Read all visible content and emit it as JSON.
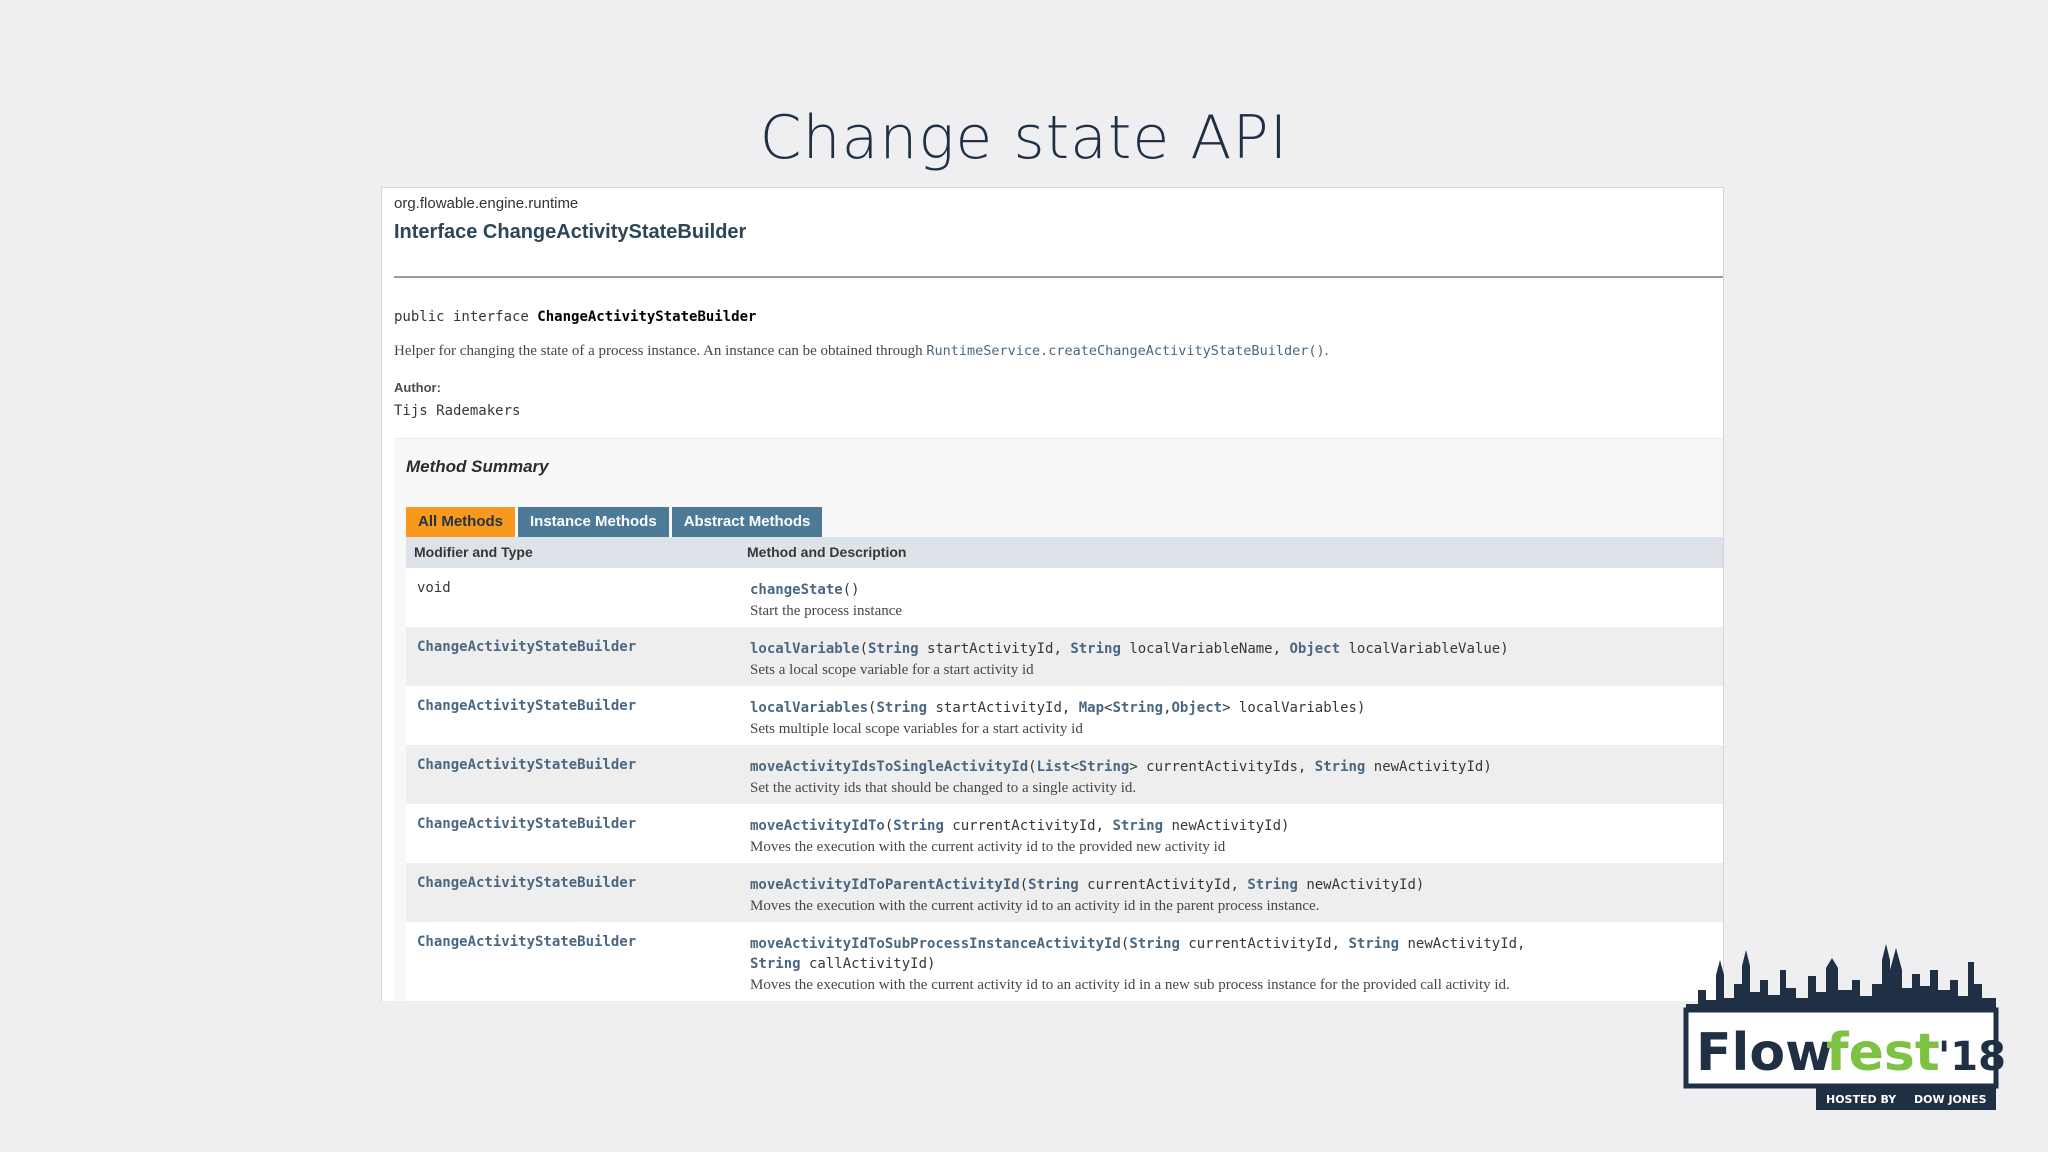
{
  "slide": {
    "title": "Change state API"
  },
  "doc": {
    "package": "org.flowable.engine.runtime",
    "interface_title": "Interface ChangeActivityStateBuilder",
    "declaration_prefix": "public interface ",
    "declaration_name": "ChangeActivityStateBuilder",
    "description_text": "Helper for changing the state of a process instance. An instance can be obtained through ",
    "description_link": "RuntimeService.createChangeActivityStateBuilder()",
    "description_end": ".",
    "author_label": "Author:",
    "author": "Tijs Rademakers"
  },
  "summary": {
    "title": "Method Summary",
    "tabs": [
      {
        "label": "All Methods",
        "active": true
      },
      {
        "label": "Instance Methods",
        "active": false
      },
      {
        "label": "Abstract Methods",
        "active": false
      }
    ],
    "headers": {
      "col1": "Modifier and Type",
      "col2": "Method and Description"
    },
    "rows": [
      {
        "type": "void",
        "link": false,
        "sig": [
          [
            "m",
            "changeState"
          ],
          [
            "p",
            "()"
          ]
        ],
        "desc": "Start the process instance"
      },
      {
        "type": "ChangeActivityStateBuilder",
        "link": true,
        "sig": [
          [
            "m",
            "localVariable"
          ],
          [
            "p",
            "("
          ],
          [
            "t",
            "String"
          ],
          [
            "p",
            " startActivityId, "
          ],
          [
            "t",
            "String"
          ],
          [
            "p",
            " localVariableName, "
          ],
          [
            "t",
            "Object"
          ],
          [
            "p",
            " localVariableValue)"
          ]
        ],
        "desc": "Sets a local scope variable for a start activity id"
      },
      {
        "type": "ChangeActivityStateBuilder",
        "link": true,
        "sig": [
          [
            "m",
            "localVariables"
          ],
          [
            "p",
            "("
          ],
          [
            "t",
            "String"
          ],
          [
            "p",
            " startActivityId, "
          ],
          [
            "t",
            "Map"
          ],
          [
            "p",
            "<"
          ],
          [
            "t",
            "String"
          ],
          [
            "p",
            ","
          ],
          [
            "t",
            "Object"
          ],
          [
            "p",
            "> localVariables)"
          ]
        ],
        "desc": "Sets multiple local scope variables for a start activity id"
      },
      {
        "type": "ChangeActivityStateBuilder",
        "link": true,
        "sig": [
          [
            "m",
            "moveActivityIdsToSingleActivityId"
          ],
          [
            "p",
            "("
          ],
          [
            "t",
            "List"
          ],
          [
            "p",
            "<"
          ],
          [
            "t",
            "String"
          ],
          [
            "p",
            "> currentActivityIds, "
          ],
          [
            "t",
            "String"
          ],
          [
            "p",
            " newActivityId)"
          ]
        ],
        "desc": "Set the activity ids that should be changed to a single activity id."
      },
      {
        "type": "ChangeActivityStateBuilder",
        "link": true,
        "sig": [
          [
            "m",
            "moveActivityIdTo"
          ],
          [
            "p",
            "("
          ],
          [
            "t",
            "String"
          ],
          [
            "p",
            " currentActivityId, "
          ],
          [
            "t",
            "String"
          ],
          [
            "p",
            " newActivityId)"
          ]
        ],
        "desc": "Moves the execution with the current activity id to the provided new activity id"
      },
      {
        "type": "ChangeActivityStateBuilder",
        "link": true,
        "sig": [
          [
            "m",
            "moveActivityIdToParentActivityId"
          ],
          [
            "p",
            "("
          ],
          [
            "t",
            "String"
          ],
          [
            "p",
            " currentActivityId, "
          ],
          [
            "t",
            "String"
          ],
          [
            "p",
            " newActivityId)"
          ]
        ],
        "desc": "Moves the execution with the current activity id to an activity id in the parent process instance."
      },
      {
        "type": "ChangeActivityStateBuilder",
        "link": true,
        "sig": [
          [
            "m",
            "moveActivityIdToSubProcessInstanceActivityId"
          ],
          [
            "p",
            "("
          ],
          [
            "t",
            "String"
          ],
          [
            "p",
            " currentActivityId, "
          ],
          [
            "t",
            "String"
          ],
          [
            "p",
            " newActivityId,\n"
          ],
          [
            "t",
            "String"
          ],
          [
            "p",
            " callActivityId)"
          ]
        ],
        "desc": "Moves the execution with the current activity id to an activity id in a new sub process instance for the provided call activity id."
      }
    ]
  },
  "logo": {
    "text_flow": "Flow",
    "text_fest": "fest",
    "text_year": "'18",
    "hosted_by": "HOSTED BY",
    "sponsor": "DOW JONES",
    "colors": {
      "dark": "#1f2f44",
      "green": "#7dc242",
      "light": "#ffffff"
    }
  }
}
